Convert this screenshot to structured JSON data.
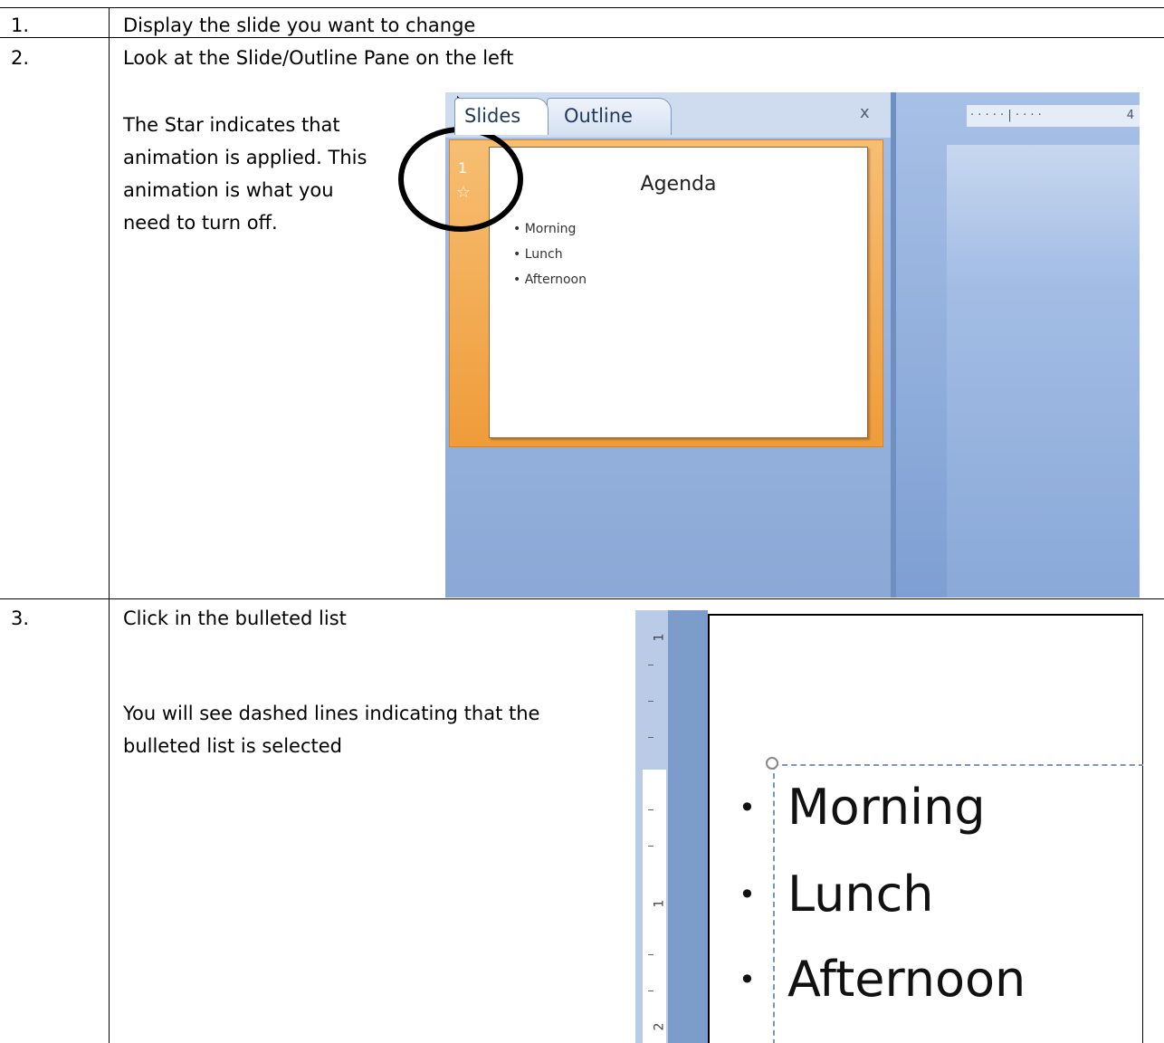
{
  "rows": [
    {
      "number": "1.",
      "text": "Display the slide you want to change"
    },
    {
      "number": "2.",
      "text": "Look at the Slide/Outline Pane on the left",
      "note_lines": [
        "The Star indicates that",
        "animation is applied. This",
        "animation is what you",
        "need to turn off."
      ]
    },
    {
      "number": "3.",
      "text": "Click in the bulleted list",
      "note_lines": [
        "You will see dashed lines indicating that the",
        "bulleted list is selected"
      ]
    }
  ],
  "screenshot1": {
    "tab_slides": "Slides",
    "tab_outline": "Outline",
    "close_glyph": "x",
    "ruler_text": "4",
    "slide_number": "1",
    "star_glyph": "☆",
    "slide_title": "Agenda",
    "slide_items": [
      "Morning",
      "Lunch",
      "Afternoon"
    ]
  },
  "screenshot2": {
    "ruler_labels": [
      "1",
      "1",
      "2"
    ],
    "items": [
      "Morning",
      "Lunch",
      "Afternoon"
    ]
  },
  "colors": {
    "pane_blue": "#8aa8d6",
    "thumb_orange": "#ef9c3a",
    "selection_dash": "#7b97b8"
  }
}
